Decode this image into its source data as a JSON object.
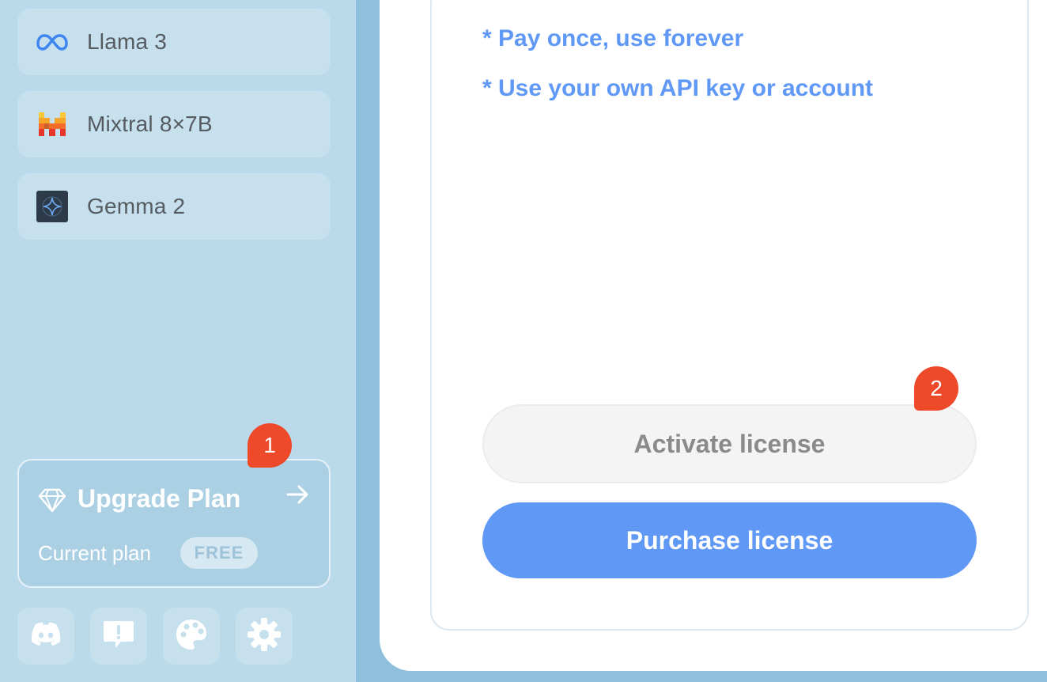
{
  "sidebar": {
    "models": [
      {
        "label": "Llama 3",
        "icon": "meta-infinity-icon"
      },
      {
        "label": "Mixtral 8×7B",
        "icon": "mistral-icon"
      },
      {
        "label": "Gemma 2",
        "icon": "gemma-sparkle-icon"
      }
    ],
    "upgrade": {
      "title": "Upgrade Plan",
      "current_plan_label": "Current plan",
      "plan_badge": "FREE",
      "icon": "diamond-icon",
      "arrow_icon": "arrow-right-icon"
    },
    "footer_icons": [
      "discord-icon",
      "feedback-icon",
      "palette-icon",
      "gear-icon"
    ]
  },
  "annotations": {
    "marker_1": "1",
    "marker_2": "2"
  },
  "main": {
    "features": [
      "* Pay once, use forever",
      "* Use your own API key or account"
    ],
    "activate_label": "Activate license",
    "purchase_label": "Purchase license"
  },
  "colors": {
    "accent": "#6098f5",
    "marker": "#ee4a2a",
    "sidebar_bg": "#bad9ea"
  }
}
